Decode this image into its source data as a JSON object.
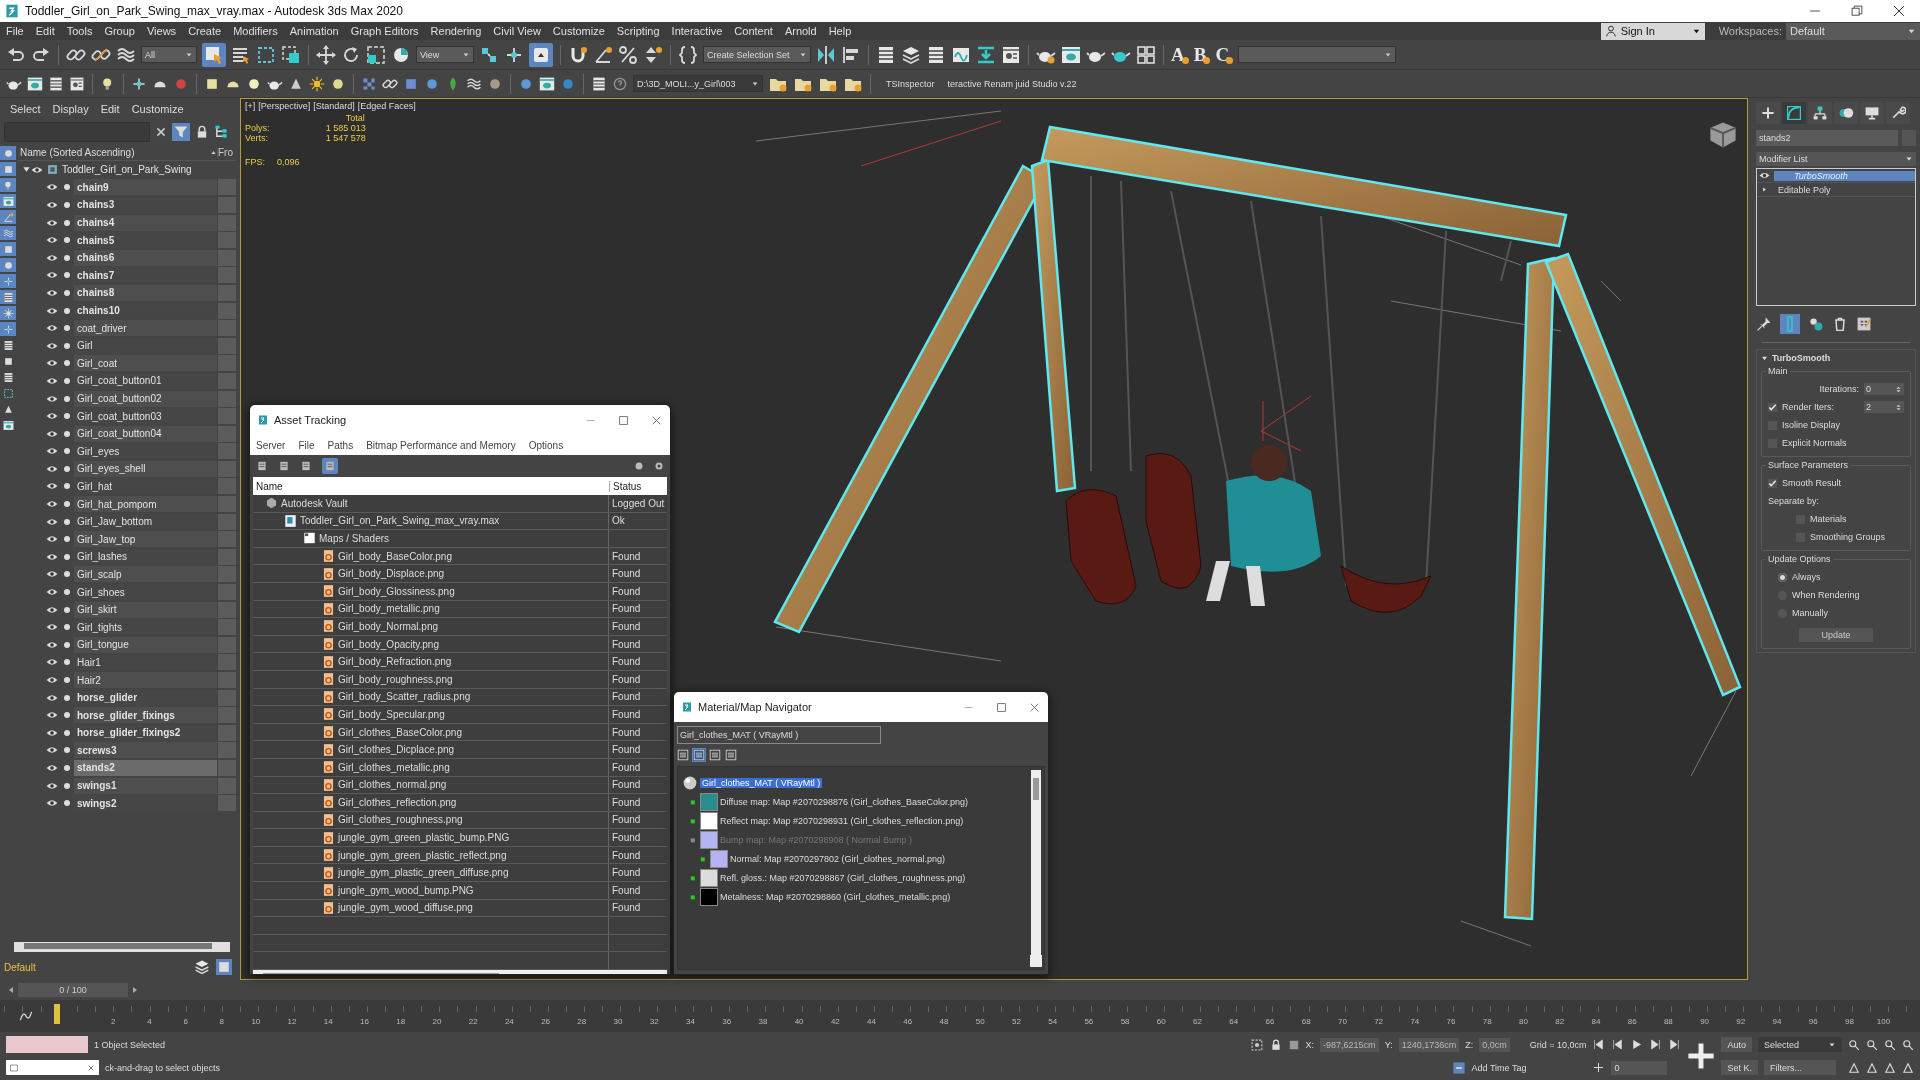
{
  "window": {
    "title": "Toddler_Girl_on_Park_Swing_max_vray.max - Autodesk 3ds Max 2020"
  },
  "menu": [
    "File",
    "Edit",
    "Tools",
    "Group",
    "Views",
    "Create",
    "Modifiers",
    "Animation",
    "Graph Editors",
    "Rendering",
    "Civil View",
    "Customize",
    "Scripting",
    "Interactive",
    "Content",
    "Arnold",
    "Help"
  ],
  "account": {
    "sign_in": "Sign In",
    "workspaces_label": "Workspaces:",
    "workspace": "Default"
  },
  "main_toolbar": {
    "selection_filter": "All",
    "reference_coord": "View",
    "selection_set": "Create Selection Set",
    "macro_buttons": [
      "A",
      "B",
      "C"
    ]
  },
  "second_toolbar": {
    "project_path": "D:\\3D_MOLI...y_Girl\\003",
    "plugins": [
      "TSInspector",
      "teractive Renam juid Studio v.22"
    ]
  },
  "scene_explorer": {
    "menu": [
      "Select",
      "Display",
      "Edit",
      "Customize"
    ],
    "filter_buttons": [
      {
        "on": true
      },
      {
        "on": true
      },
      {
        "on": true
      },
      {
        "on": true
      },
      {
        "on": true
      },
      {
        "on": true
      },
      {
        "on": true
      },
      {
        "on": true
      },
      {
        "on": true
      },
      {
        "on": true
      },
      {
        "on": true
      },
      {
        "on": true
      },
      {
        "on": false
      },
      {
        "on": false
      },
      {
        "on": false
      },
      {
        "on": false
      },
      {
        "on": false
      },
      {
        "on": false
      }
    ],
    "column": "Name (Sorted Ascending)",
    "column_2": "Fro",
    "root": "Toddler_Girl_on_Park_Swing",
    "objects": [
      {
        "name": "chain9",
        "bold": true,
        "selected": false
      },
      {
        "name": "chains3",
        "bold": true,
        "selected": false
      },
      {
        "name": "chains4",
        "bold": true,
        "selected": false
      },
      {
        "name": "chains5",
        "bold": true,
        "selected": false
      },
      {
        "name": "chains6",
        "bold": true,
        "selected": false
      },
      {
        "name": "chains7",
        "bold": true,
        "selected": false
      },
      {
        "name": "chains8",
        "bold": true,
        "selected": false
      },
      {
        "name": "chains10",
        "bold": true,
        "selected": false
      },
      {
        "name": "coat_driver",
        "bold": false,
        "selected": false
      },
      {
        "name": "Girl",
        "bold": false,
        "selected": false
      },
      {
        "name": "Girl_coat",
        "bold": false,
        "selected": false
      },
      {
        "name": "Girl_coat_button01",
        "bold": false,
        "selected": false
      },
      {
        "name": "Girl_coat_button02",
        "bold": false,
        "selected": false
      },
      {
        "name": "Girl_coat_button03",
        "bold": false,
        "selected": false
      },
      {
        "name": "Girl_coat_button04",
        "bold": false,
        "selected": false
      },
      {
        "name": "Girl_eyes",
        "bold": false,
        "selected": false
      },
      {
        "name": "Girl_eyes_shell",
        "bold": false,
        "selected": false
      },
      {
        "name": "Girl_hat",
        "bold": false,
        "selected": false
      },
      {
        "name": "Girl_hat_pompom",
        "bold": false,
        "selected": false
      },
      {
        "name": "Girl_Jaw_bottom",
        "bold": false,
        "selected": false
      },
      {
        "name": "Girl_Jaw_top",
        "bold": false,
        "selected": false
      },
      {
        "name": "Girl_lashes",
        "bold": false,
        "selected": false
      },
      {
        "name": "Girl_scalp",
        "bold": false,
        "selected": false
      },
      {
        "name": "Girl_shoes",
        "bold": false,
        "selected": false
      },
      {
        "name": "Girl_skirt",
        "bold": false,
        "selected": false
      },
      {
        "name": "Girl_tights",
        "bold": false,
        "selected": false
      },
      {
        "name": "Girl_tongue",
        "bold": false,
        "selected": false
      },
      {
        "name": "Hair1",
        "bold": false,
        "selected": false
      },
      {
        "name": "Hair2",
        "bold": false,
        "selected": false
      },
      {
        "name": "horse_glider",
        "bold": true,
        "selected": false
      },
      {
        "name": "horse_glider_fixings",
        "bold": true,
        "selected": false
      },
      {
        "name": "horse_glider_fixings2",
        "bold": true,
        "selected": false
      },
      {
        "name": "screws3",
        "bold": true,
        "selected": false
      },
      {
        "name": "stands2",
        "bold": true,
        "selected": true
      },
      {
        "name": "swings1",
        "bold": true,
        "selected": false
      },
      {
        "name": "swings2",
        "bold": true,
        "selected": false
      }
    ],
    "layer": "Default"
  },
  "viewport": {
    "labels": [
      "[+]",
      "[Perspective]",
      "[Standard]",
      "[Edged Faces]"
    ],
    "stats_header": "Total",
    "stats": [
      {
        "label": "Polys:",
        "value": "1 585 013"
      },
      {
        "label": "Verts:",
        "value": "1 547 578"
      }
    ],
    "fps_label": "FPS:",
    "fps": "0,096"
  },
  "asset_tracking": {
    "title": "Asset Tracking",
    "menu": [
      "Server",
      "File",
      "Paths",
      "Bitmap Performance and Memory",
      "Options"
    ],
    "tools": [
      {
        "selected": false
      },
      {
        "selected": false
      },
      {
        "selected": false
      },
      {
        "selected": true
      }
    ],
    "columns": [
      "Name",
      "Status"
    ],
    "rows": [
      {
        "name": "Autodesk Vault",
        "status": "Logged Out",
        "kind": "vault",
        "children": [
          {
            "name": "Toddler_Girl_on_Park_Swing_max_vray.max",
            "status": "Ok",
            "kind": "scene",
            "children": [
              {
                "name": "Maps / Shaders",
                "kind": "folder",
                "children": [
                  {
                    "name": "Girl_body_BaseColor.png",
                    "status": "Found",
                    "kind": "bitmap"
                  },
                  {
                    "name": "Girl_body_Displace.png",
                    "status": "Found",
                    "kind": "bitmap"
                  },
                  {
                    "name": "Girl_body_Glossiness.png",
                    "status": "Found",
                    "kind": "bitmap"
                  },
                  {
                    "name": "Girl_body_metallic.png",
                    "status": "Found",
                    "kind": "bitmap"
                  },
                  {
                    "name": "Girl_body_Normal.png",
                    "status": "Found",
                    "kind": "bitmap"
                  },
                  {
                    "name": "Girl_body_Opacity.png",
                    "status": "Found",
                    "kind": "bitmap"
                  },
                  {
                    "name": "Girl_body_Refraction.png",
                    "status": "Found",
                    "kind": "bitmap"
                  },
                  {
                    "name": "Girl_body_roughness.png",
                    "status": "Found",
                    "kind": "bitmap"
                  },
                  {
                    "name": "Girl_body_Scatter_radius.png",
                    "status": "Found",
                    "kind": "bitmap"
                  },
                  {
                    "name": "Girl_body_Specular.png",
                    "status": "Found",
                    "kind": "bitmap"
                  },
                  {
                    "name": "Girl_clothes_BaseColor.png",
                    "status": "Found",
                    "kind": "bitmap"
                  },
                  {
                    "name": "Girl_clothes_Dicplace.png",
                    "status": "Found",
                    "kind": "bitmap"
                  },
                  {
                    "name": "Girl_clothes_metallic.png",
                    "status": "Found",
                    "kind": "bitmap"
                  },
                  {
                    "name": "Girl_clothes_normal.png",
                    "status": "Found",
                    "kind": "bitmap"
                  },
                  {
                    "name": "Girl_clothes_reflection.png",
                    "status": "Found",
                    "kind": "bitmap"
                  },
                  {
                    "name": "Girl_clothes_roughness.png",
                    "status": "Found",
                    "kind": "bitmap"
                  },
                  {
                    "name": "jungle_gym_green_plastic_bump.PNG",
                    "status": "Found",
                    "kind": "bitmap"
                  },
                  {
                    "name": "jungle_gym_green_plastic_reflect.png",
                    "status": "Found",
                    "kind": "bitmap"
                  },
                  {
                    "name": "jungle_gym_plastic_green_diffuse.png",
                    "status": "Found",
                    "kind": "bitmap"
                  },
                  {
                    "name": "jungle_gym_wood_bump.PNG",
                    "status": "Found",
                    "kind": "bitmap"
                  },
                  {
                    "name": "jungle_gym_wood_diffuse.png",
                    "status": "Found",
                    "kind": "bitmap"
                  }
                ]
              }
            ]
          }
        ]
      }
    ]
  },
  "material_navigator": {
    "title": "Material/Map Navigator",
    "field": "Girl_clothes_MAT  ( VRayMtl )",
    "tools": [
      {
        "selected": false
      },
      {
        "selected": true
      },
      {
        "selected": false
      },
      {
        "selected": false
      }
    ],
    "tree": {
      "label": "Girl_clothes_MAT  ( VRayMtl )",
      "selected": true,
      "children": [
        {
          "label": "Diffuse map: Map #2070298876 (Girl_clothes_BaseColor.png)",
          "disabled": false,
          "color": "#2a8c8c"
        },
        {
          "label": "Reflect map: Map #2070298931 (Girl_clothes_reflection.png)",
          "disabled": false,
          "color": "#ffffff"
        },
        {
          "label": "Bump map: Map #2070298908  ( Normal Bump )",
          "disabled": true,
          "color": "#b4b4f4",
          "children": [
            {
              "label": "Normal: Map #2070297802 (Girl_clothes_normal.png)",
              "disabled": false,
              "color": "#b4b4f4"
            }
          ]
        },
        {
          "label": "Refl. gloss.: Map #2070298867 (Girl_clothes_roughness.png)",
          "disabled": false,
          "color": "#dcdcdc"
        },
        {
          "label": "Metalness: Map #2070298860 (Girl_clothes_metallic.png)",
          "disabled": false,
          "color": "#000000"
        }
      ]
    }
  },
  "command_panel": {
    "tabs": [
      {
        "selected": false
      },
      {
        "selected": true
      },
      {
        "selected": false
      },
      {
        "selected": false
      },
      {
        "selected": false
      },
      {
        "selected": false
      }
    ],
    "object_name": "stands2",
    "modifier_list": "Modifier List",
    "stack": [
      {
        "name": "TurboSmooth",
        "selected": true
      },
      {
        "name": "Editable Poly",
        "selected": false
      }
    ],
    "rollout": {
      "title": "TurboSmooth",
      "main": {
        "title": "Main",
        "iterations_label": "Iterations:",
        "iterations": "0",
        "render_iters": {
          "label": "Render Iters:",
          "checked": true,
          "value": "2"
        },
        "options": [
          {
            "label": "Isoline Display",
            "checked": false
          },
          {
            "label": "Explicit Normals",
            "checked": false
          }
        ]
      },
      "surface": {
        "title": "Surface Parameters",
        "smooth_result": {
          "label": "Smooth Result",
          "checked": true
        },
        "separate_label": "Separate by:",
        "separate": [
          {
            "label": "Materials",
            "checked": false
          },
          {
            "label": "Smoothing Groups",
            "checked": false
          }
        ]
      },
      "update": {
        "title": "Update Options",
        "options": [
          {
            "label": "Always",
            "selected": true
          },
          {
            "label": "When Rendering",
            "selected": false
          },
          {
            "label": "Manually",
            "selected": false
          }
        ],
        "button": "Update"
      }
    }
  },
  "timeline": {
    "slider": "0 / 100",
    "ticks": [
      "2",
      "4",
      "6",
      "8",
      "10",
      "12",
      "14",
      "16",
      "18",
      "20",
      "22",
      "24",
      "26",
      "28",
      "30",
      "32",
      "34",
      "36",
      "38",
      "40",
      "42",
      "44",
      "46",
      "48",
      "50",
      "52",
      "54",
      "56",
      "58",
      "60",
      "62",
      "64",
      "66",
      "68",
      "70",
      "72",
      "74",
      "76",
      "78",
      "80",
      "82",
      "84",
      "86",
      "88",
      "90",
      "92",
      "94",
      "96",
      "98",
      "100"
    ]
  },
  "status_bar": {
    "selection": "1 Object Selected",
    "prompt": "ck-and-drag to select objects",
    "coords": [
      {
        "label": "X:",
        "value": "-987,6215cm"
      },
      {
        "label": "Y:",
        "value": "1240,1736cm"
      },
      {
        "label": "Z:",
        "value": "0,0cm"
      }
    ],
    "grid": "Grid = 10,0cm",
    "time_tag": "Add Time Tag",
    "auto_key": "Auto",
    "key_mode": "Selected",
    "set_key": "Set K.",
    "filters": "Filters...",
    "frame": "0"
  }
}
